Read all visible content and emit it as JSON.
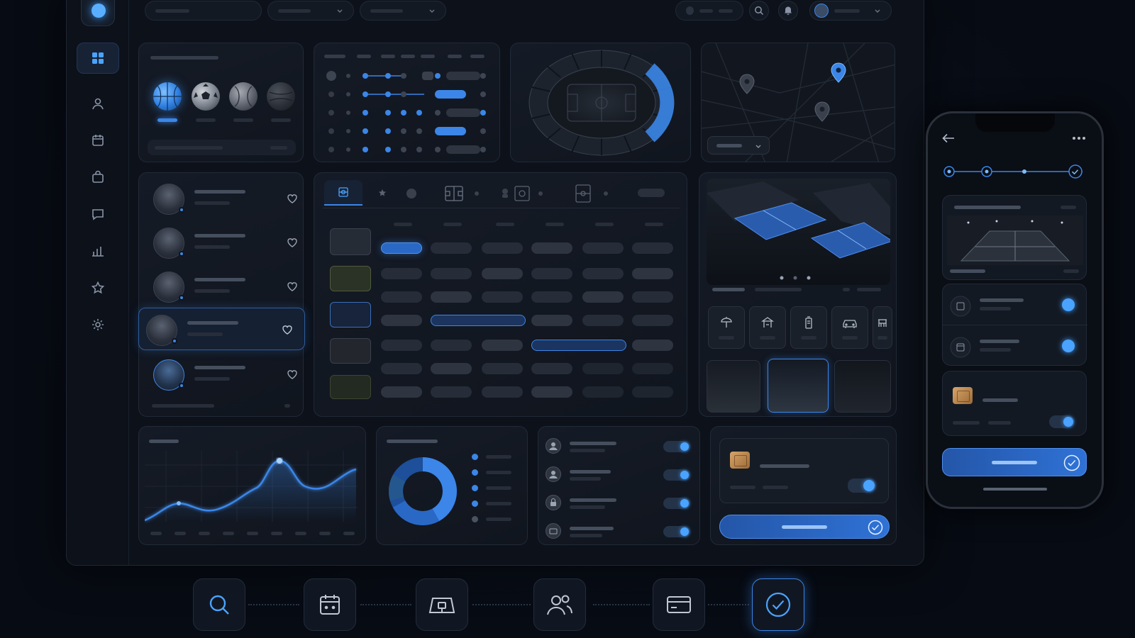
{
  "theme": {
    "accent": "#3b86e8",
    "background": "#070b13",
    "panel": "#151b26"
  },
  "sidebar": {
    "items": [
      {
        "icon": "dashboard-grid-icon",
        "active": true
      },
      {
        "icon": "user-icon",
        "active": false
      },
      {
        "icon": "calendar-icon",
        "active": false
      },
      {
        "icon": "bag-icon",
        "active": false
      },
      {
        "icon": "chat-icon",
        "active": false
      },
      {
        "icon": "bar-chart-icon",
        "active": false
      },
      {
        "icon": "star-icon",
        "active": false
      },
      {
        "icon": "gear-icon",
        "active": false
      }
    ]
  },
  "topbar": {
    "icons": [
      "search-icon",
      "bell-icon",
      "chevron-down-icon"
    ]
  },
  "sports": {
    "items": [
      "basketball",
      "soccer-ball",
      "tennis-ball",
      "ball"
    ],
    "selected": "basketball"
  },
  "map": {
    "pins": [
      "map-pin-icon",
      "map-pin-icon",
      "map-pin-icon"
    ],
    "highlighted_pin": 1
  },
  "players": {
    "items": [
      {
        "favorite": false
      },
      {
        "favorite": false
      },
      {
        "favorite": false
      },
      {
        "favorite": false,
        "selected": true
      },
      {
        "favorite": false
      }
    ]
  },
  "venue": {
    "amenities": [
      "umbrella-icon",
      "pavilion-icon",
      "locker-icon",
      "car-icon",
      "bench-icon"
    ],
    "thumbnails": 3,
    "selected_thumbnail": 1,
    "carousel_dots": 3
  },
  "bottom_nav": {
    "steps": [
      "search-icon",
      "calendar-icon",
      "court-icon",
      "users-icon",
      "card-icon",
      "check-icon"
    ],
    "active": "check-icon"
  },
  "phone": {
    "steps": 4,
    "completed": 4
  }
}
